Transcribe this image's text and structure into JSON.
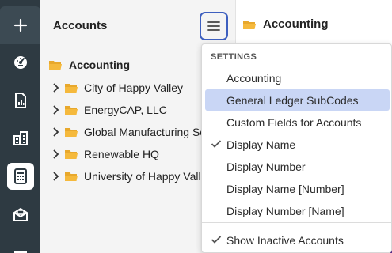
{
  "accounts_panel": {
    "title": "Accounts",
    "tree": {
      "root": "Accounting",
      "items": [
        "City of Happy Valley",
        "EnergyCAP, LLC",
        "Global Manufacturing Services",
        "Renewable HQ",
        "University of Happy Valley"
      ]
    }
  },
  "main": {
    "title": "Accounting"
  },
  "menu": {
    "heading": "SETTINGS",
    "items": [
      {
        "label": "Accounting",
        "checked": false,
        "selected": false
      },
      {
        "label": "General Ledger SubCodes",
        "checked": false,
        "selected": true
      },
      {
        "label": "Custom Fields for Accounts",
        "checked": false,
        "selected": false
      },
      {
        "label": "Display Name",
        "checked": true,
        "selected": false
      },
      {
        "label": "Display Number",
        "checked": false,
        "selected": false
      },
      {
        "label": "Display Name [Number]",
        "checked": false,
        "selected": false
      },
      {
        "label": "Display Number [Name]",
        "checked": false,
        "selected": false
      }
    ],
    "footer_item": {
      "label": "Show Inactive Accounts",
      "checked": true
    }
  },
  "rail": {
    "items": [
      "add-icon",
      "dashboard-icon",
      "report-icon",
      "buildings-icon",
      "calculator-icon",
      "bills-icon",
      "menu-lines-icon"
    ],
    "active": "calculator-icon"
  },
  "colors": {
    "rail": "#2e3a42",
    "accent": "#3d5fbf",
    "selected": "#c9d6f5",
    "folder": "#f5b93c",
    "purple": "#5c2d91"
  }
}
